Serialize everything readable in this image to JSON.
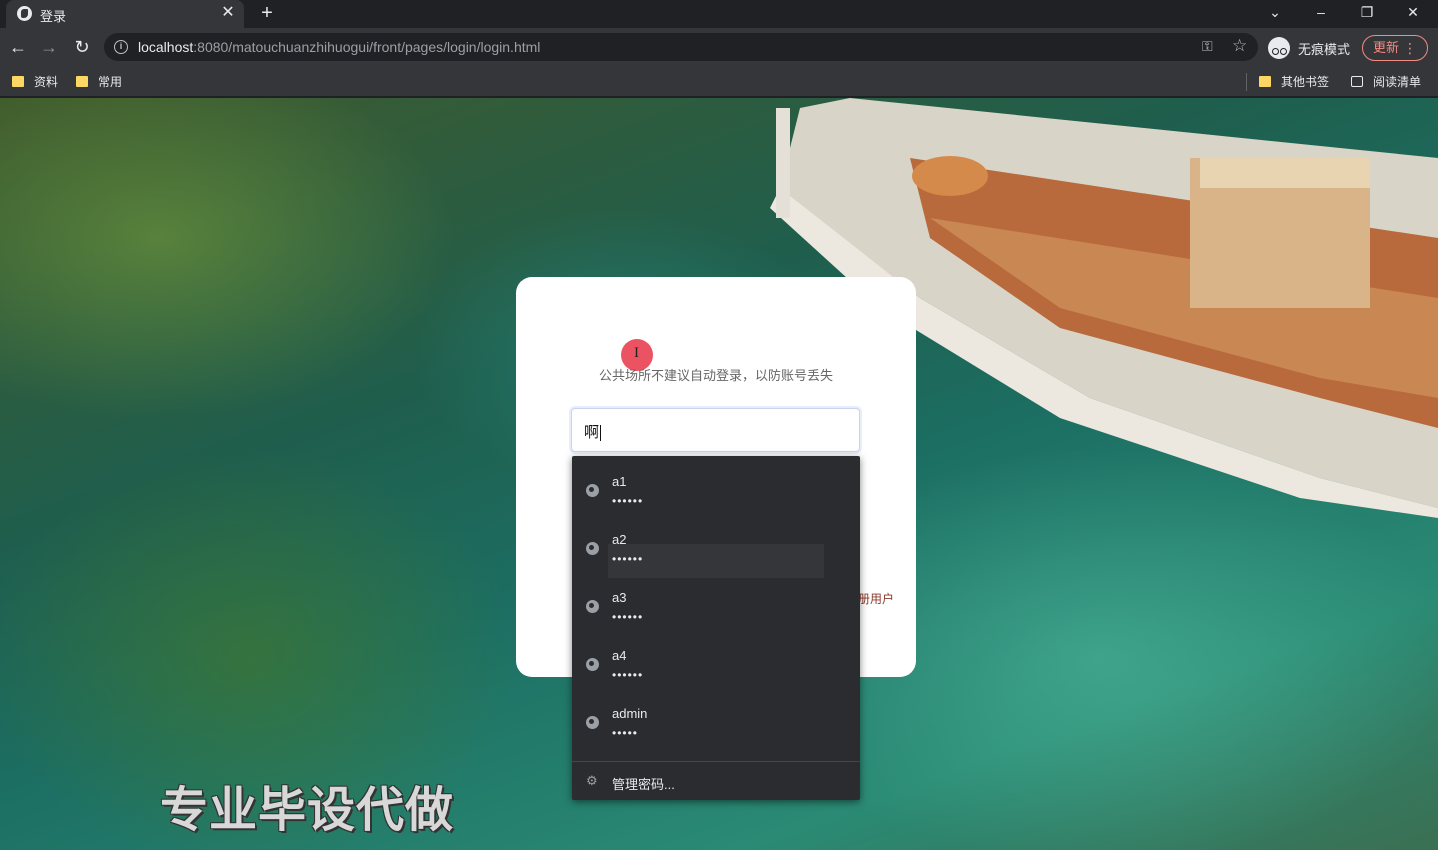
{
  "browser": {
    "tab_title": "登录",
    "tab_close": "✕",
    "new_tab": "+",
    "url_host": "localhost",
    "url_rest": ":8080/matouchuanzhihuogui/front/pages/login/login.html",
    "incognito_label": "无痕模式",
    "update_label": "更新",
    "bookmarks": [
      {
        "label": "资料"
      },
      {
        "label": "常用"
      }
    ],
    "bookmarks_right": [
      {
        "label": "其他书签"
      },
      {
        "label": "阅读清单"
      }
    ]
  },
  "login": {
    "hint": "公共场所不建议自动登录，以防账号丢失",
    "username_value": "啊",
    "register_text": "册用户"
  },
  "autofill": {
    "items": [
      {
        "username": "a1",
        "password": "••••••"
      },
      {
        "username": "a2",
        "password": "••••••"
      },
      {
        "username": "a3",
        "password": "••••••"
      },
      {
        "username": "a4",
        "password": "••••••"
      },
      {
        "username": "admin",
        "password": "•••••"
      }
    ],
    "manage_label": "管理密码..."
  },
  "overlay": {
    "watermark": "专业毕设代做"
  },
  "colors": {
    "chrome_dark": "#202124",
    "chrome_toolbar": "#35363a",
    "update_accent": "#f28b82",
    "bookmark_folder": "#fdd663"
  }
}
